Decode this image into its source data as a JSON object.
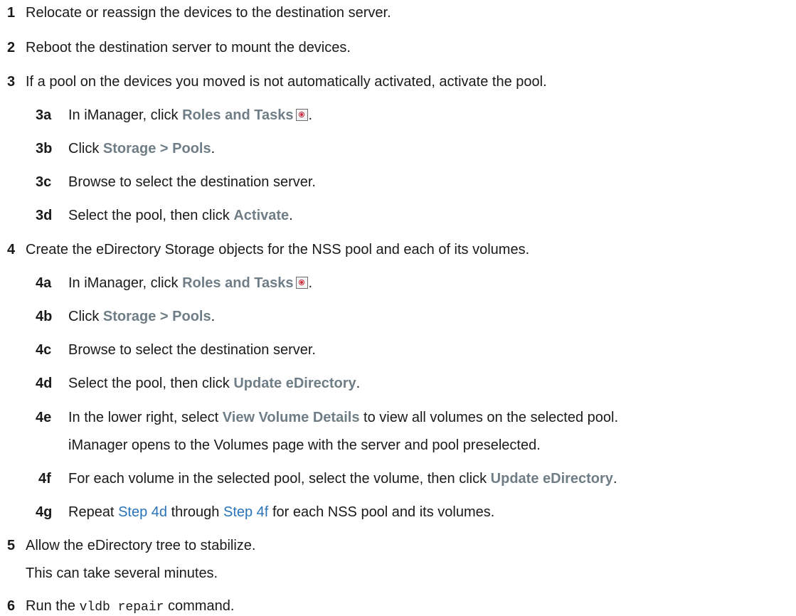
{
  "steps": {
    "s1": {
      "num": "1",
      "text": "Relocate or reassign the devices to the destination server."
    },
    "s2": {
      "num": "2",
      "text": "Reboot the destination server to mount the devices."
    },
    "s3": {
      "num": "3",
      "text": "If a pool on the devices you moved is not automatically activated, activate the pool."
    },
    "s3a": {
      "num": "3a",
      "pre": "In iManager, click",
      "ui": "Roles and Tasks",
      "post": "."
    },
    "s3b": {
      "num": "3b",
      "pre": "Click",
      "ui": "Storage > Pools",
      "post": "."
    },
    "s3c": {
      "num": "3c",
      "text": "Browse to select the destination server."
    },
    "s3d": {
      "num": "3d",
      "pre": "Select the pool, then click",
      "ui": "Activate",
      "post": "."
    },
    "s4": {
      "num": "4",
      "text": "Create the eDirectory Storage objects for the NSS pool and each of its volumes."
    },
    "s4a": {
      "num": "4a",
      "pre": "In iManager, click",
      "ui": "Roles and Tasks",
      "post": "."
    },
    "s4b": {
      "num": "4b",
      "pre": "Click",
      "ui": "Storage > Pools",
      "post": "."
    },
    "s4c": {
      "num": "4c",
      "text": "Browse to select the destination server."
    },
    "s4d": {
      "num": "4d",
      "pre": "Select the pool, then click",
      "ui": "Update eDirectory",
      "post": "."
    },
    "s4e": {
      "num": "4e",
      "pre": "In the lower right, select",
      "ui": "View Volume Details",
      "post": "to view all volumes on the selected pool.",
      "note": "iManager opens to the Volumes page with the server and pool preselected."
    },
    "s4f": {
      "num": "4f",
      "pre": "For each volume in the selected pool, select the volume, then click",
      "ui": "Update eDirectory",
      "post": "."
    },
    "s4g": {
      "num": "4g",
      "pre": "Repeat",
      "link1": "Step 4d",
      "mid": "through",
      "link2": "Step 4f",
      "post": "for each NSS pool and its volumes."
    },
    "s5": {
      "num": "5",
      "text": "Allow the eDirectory tree to stabilize.",
      "note": "This can take several minutes."
    },
    "s6": {
      "num": "6",
      "pre": "Run the",
      "code": "vldb repair",
      "post": "command."
    }
  }
}
